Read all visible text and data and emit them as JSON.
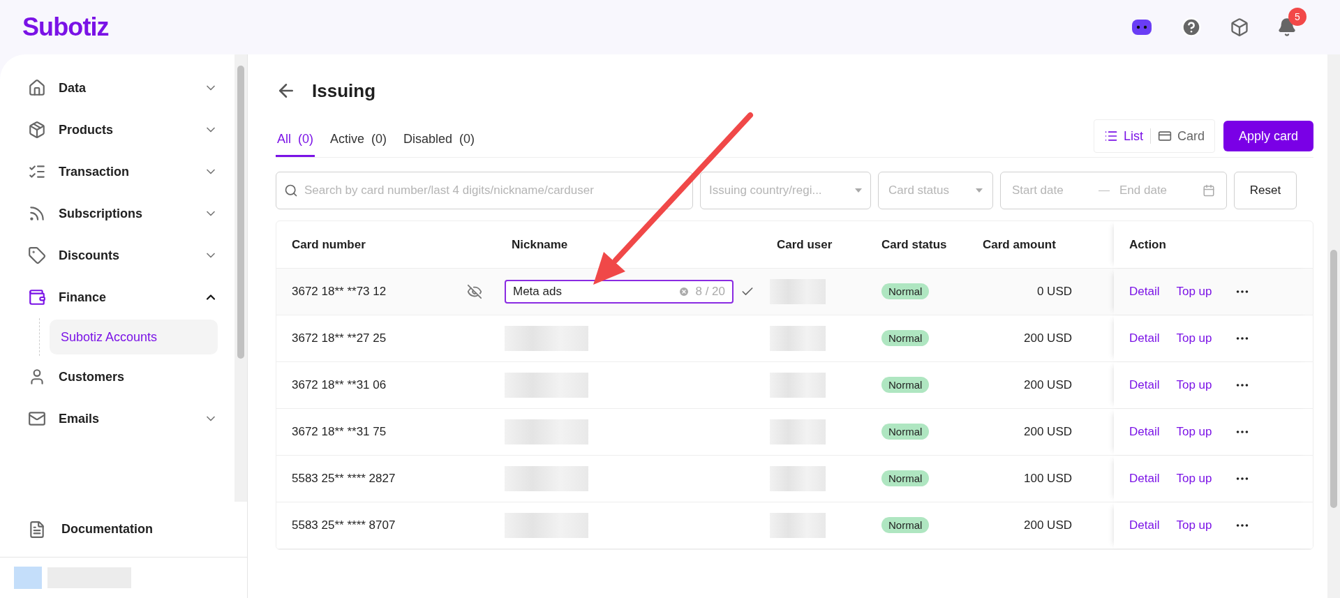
{
  "brand": "Subotiz",
  "header": {
    "notification_count": "5"
  },
  "sidebar": {
    "items": [
      {
        "label": "Data",
        "expandable": true,
        "expanded": false,
        "selected": false
      },
      {
        "label": "Products",
        "expandable": true,
        "expanded": false,
        "selected": false
      },
      {
        "label": "Transaction",
        "expandable": true,
        "expanded": false,
        "selected": false
      },
      {
        "label": "Subscriptions",
        "expandable": true,
        "expanded": false,
        "selected": false
      },
      {
        "label": "Discounts",
        "expandable": true,
        "expanded": false,
        "selected": false
      },
      {
        "label": "Finance",
        "expandable": true,
        "expanded": true,
        "selected": true,
        "children": [
          {
            "label": "Subotiz Accounts",
            "selected": true
          }
        ]
      },
      {
        "label": "Customers",
        "expandable": false,
        "selected": false
      },
      {
        "label": "Emails",
        "expandable": true,
        "expanded": false,
        "selected": false
      }
    ],
    "footer": {
      "label": "Documentation"
    }
  },
  "page": {
    "title": "Issuing",
    "tabs": [
      {
        "label": "All",
        "count": "(0)",
        "selected": true
      },
      {
        "label": "Active",
        "count": "(0)",
        "selected": false
      },
      {
        "label": "Disabled",
        "count": "(0)",
        "selected": false
      }
    ],
    "view_toggle": [
      {
        "label": "List",
        "selected": true
      },
      {
        "label": "Card",
        "selected": false
      }
    ],
    "apply_button": "Apply card",
    "filters": {
      "search_placeholder": "Search by card number/last 4 digits/nickname/carduser",
      "country_placeholder": "Issuing country/regi...",
      "status_placeholder": "Card status",
      "start_placeholder": "Start date",
      "end_placeholder": "End date",
      "reset": "Reset"
    },
    "table": {
      "columns": [
        "Card number",
        "Nickname",
        "Card user",
        "Card status",
        "Card amount",
        "Action"
      ],
      "rows": [
        {
          "card_number": "3672 18** **73 12",
          "editing": true,
          "nickname_value": "Meta ads",
          "nickname_counter": "8 / 20",
          "status": "Normal",
          "amount": "0 USD",
          "actions": [
            "Detail",
            "Top up"
          ]
        },
        {
          "card_number": "3672 18** **27 25",
          "editing": false,
          "status": "Normal",
          "amount": "200 USD",
          "actions": [
            "Detail",
            "Top up"
          ]
        },
        {
          "card_number": "3672 18** **31 06",
          "editing": false,
          "status": "Normal",
          "amount": "200 USD",
          "actions": [
            "Detail",
            "Top up"
          ]
        },
        {
          "card_number": "3672 18** **31 75",
          "editing": false,
          "status": "Normal",
          "amount": "200 USD",
          "actions": [
            "Detail",
            "Top up"
          ]
        },
        {
          "card_number": "5583 25** **** 2827",
          "editing": false,
          "status": "Normal",
          "amount": "100 USD",
          "actions": [
            "Detail",
            "Top up"
          ]
        },
        {
          "card_number": "5583 25** **** 8707",
          "editing": false,
          "status": "Normal",
          "amount": "200 USD",
          "actions": [
            "Detail",
            "Top up"
          ]
        }
      ]
    }
  }
}
